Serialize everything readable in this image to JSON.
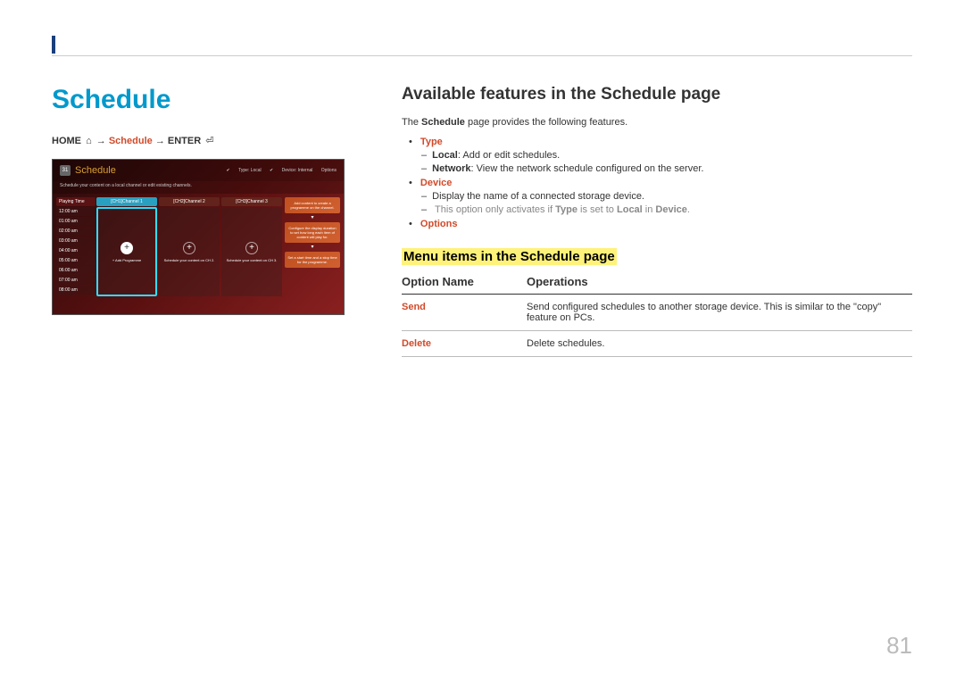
{
  "page_number": "81",
  "left": {
    "title": "Schedule",
    "breadcrumb": {
      "home": "HOME",
      "schedule": "Schedule",
      "enter": "ENTER",
      "arrow": "→"
    },
    "screenshot": {
      "title": "Schedule",
      "cal_day": "31",
      "type_label": "Type: Local",
      "device_label": "Device: Internal",
      "options_label": "Options",
      "subtitle": "Schedule your content on a local channel or edit existing channels.",
      "time_header": "Playing Time",
      "times": [
        "12:00 am",
        "01:00 am",
        "02:00 am",
        "03:00 am",
        "04:00 am",
        "05:00 am",
        "06:00 am",
        "07:00 am",
        "08:00 am"
      ],
      "channels": [
        {
          "header": "[CH1]Channel 1",
          "plus_label": "+ Add Programme"
        },
        {
          "header": "[CH2]Channel 2",
          "plus_label": "Schedule your content on CH 2."
        },
        {
          "header": "[CH3]Channel 3",
          "plus_label": "Schedule your content on CH 3."
        }
      ],
      "right_boxes": [
        "Add content to create a programme on the channel.",
        "Configure the display duration to set how long each item of content will play for.",
        "Set a start time and a stop time for the programme."
      ]
    }
  },
  "right": {
    "title": "Available features in the Schedule page",
    "intro_pre": "The ",
    "intro_bold": "Schedule",
    "intro_post": " page provides the following features.",
    "features": {
      "type": {
        "label": "Type",
        "local_label": "Local",
        "local_text": ": Add or edit schedules.",
        "network_label": "Network",
        "network_text": ": View the network schedule configured on the server."
      },
      "device": {
        "label": "Device",
        "line1": "Display the name of a connected storage device.",
        "note_pre": "This option only activates if ",
        "note_type": "Type",
        "note_mid": " is set to ",
        "note_local": "Local",
        "note_mid2": " in ",
        "note_device": "Device",
        "note_end": "."
      },
      "options": {
        "label": "Options"
      }
    },
    "menu_heading": "Menu items in the Schedule page",
    "table": {
      "col1": "Option Name",
      "col2": "Operations",
      "rows": [
        {
          "name": "Send",
          "desc": "Send configured schedules to another storage device. This is similar to the \"copy\" feature on PCs."
        },
        {
          "name": "Delete",
          "desc": "Delete schedules."
        }
      ]
    }
  }
}
